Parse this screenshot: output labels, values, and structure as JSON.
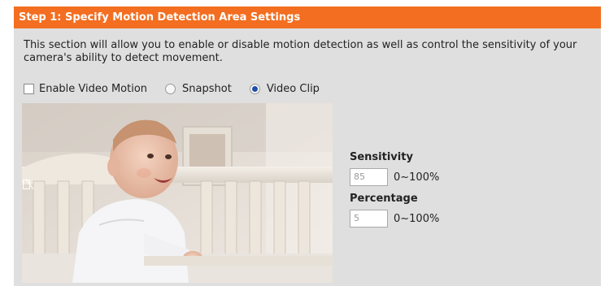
{
  "header": {
    "title": "Step 1: Specify Motion Detection Area Settings"
  },
  "description": "This section will allow you to enable or disable motion detection as well as control the sensitivity of your camera's ability to detect movement.",
  "options": {
    "enable_label": "Enable Video Motion",
    "enable_checked": false,
    "snapshot_label": "Snapshot",
    "videoclip_label": "Video Clip",
    "selected_mode": "Video Clip"
  },
  "sensitivity": {
    "label": "Sensitivity",
    "value": "85",
    "range": "0~100%"
  },
  "percentage": {
    "label": "Percentage",
    "value": "5",
    "range": "0~100%"
  },
  "colors": {
    "header_bg": "#f36e20",
    "panel_bg": "#dfdfdf",
    "radio_selected": "#1f4fa8"
  }
}
